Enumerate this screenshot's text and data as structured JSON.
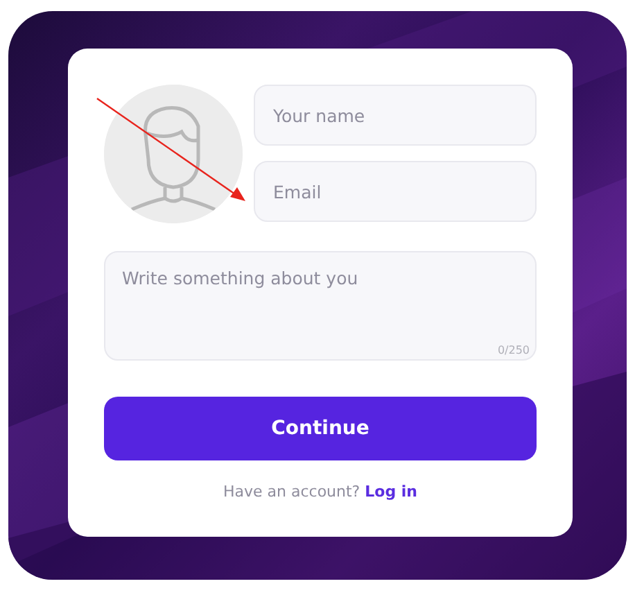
{
  "profile_form": {
    "avatar": {
      "kind": "placeholder"
    },
    "name_field": {
      "placeholder": "Your name"
    },
    "email_field": {
      "placeholder": "Email"
    },
    "about_field": {
      "placeholder": "Write something about you",
      "counter": "0/250"
    },
    "continue_button": "Continue",
    "login_prompt": {
      "text": "Have an account?",
      "link": "Log in"
    }
  }
}
